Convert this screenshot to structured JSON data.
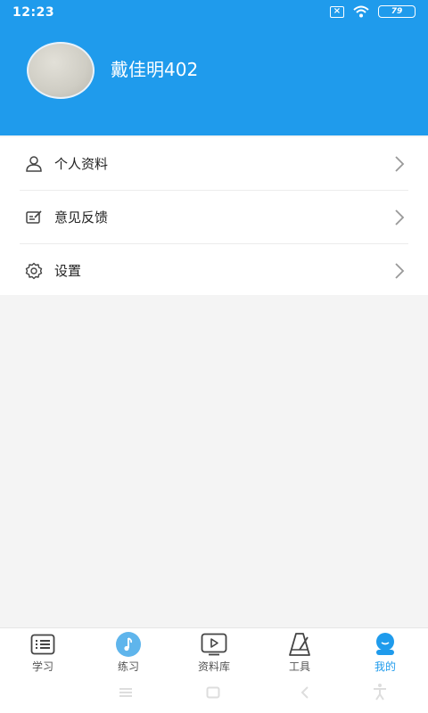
{
  "status": {
    "time": "12:23",
    "battery": "79"
  },
  "profile": {
    "username": "戴佳明402"
  },
  "menu": [
    {
      "label": "个人资料",
      "icon": "person-icon"
    },
    {
      "label": "意见反馈",
      "icon": "feedback-icon"
    },
    {
      "label": "设置",
      "icon": "gear-icon"
    }
  ],
  "tabs": [
    {
      "label": "学习",
      "icon": "list-icon",
      "active": false
    },
    {
      "label": "练习",
      "icon": "music-note-icon",
      "active": false
    },
    {
      "label": "资料库",
      "icon": "video-icon",
      "active": false
    },
    {
      "label": "工具",
      "icon": "metronome-icon",
      "active": false
    },
    {
      "label": "我的",
      "icon": "profile-icon",
      "active": true
    }
  ],
  "colors": {
    "accent": "#1f9bec",
    "background": "#f4f4f4"
  }
}
